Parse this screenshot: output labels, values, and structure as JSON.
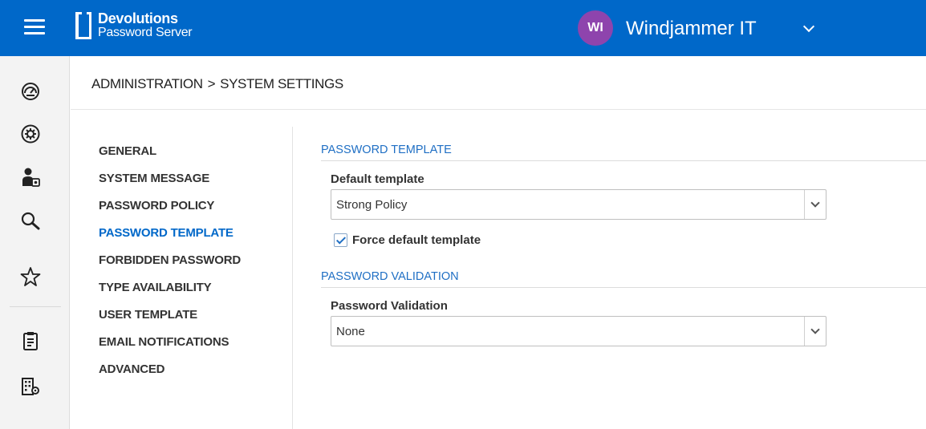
{
  "header": {
    "logo_line1": "Devolutions",
    "logo_line2": "Password Server",
    "account_initials": "WI",
    "account_name": "Windjammer IT",
    "brand_color": "#0068c9",
    "avatar_color": "#8e44ad"
  },
  "rail": {
    "icons": [
      "dashboard-icon",
      "settings-gear-icon",
      "user-admin-icon",
      "search-icon",
      "favorites-star-icon",
      "clipboard-report-icon",
      "org-settings-icon"
    ]
  },
  "breadcrumb": {
    "part1": "ADMINISTRATION",
    "separator": ">",
    "part2": "SYSTEM SETTINGS"
  },
  "nav": {
    "items": [
      {
        "label": "GENERAL"
      },
      {
        "label": "SYSTEM MESSAGE"
      },
      {
        "label": "PASSWORD POLICY"
      },
      {
        "label": "PASSWORD TEMPLATE",
        "active": true
      },
      {
        "label": "FORBIDDEN PASSWORD"
      },
      {
        "label": "TYPE AVAILABILITY"
      },
      {
        "label": "USER TEMPLATE"
      },
      {
        "label": "EMAIL NOTIFICATIONS"
      },
      {
        "label": "ADVANCED"
      }
    ]
  },
  "password_template": {
    "section_title": "PASSWORD TEMPLATE",
    "default_template_label": "Default template",
    "default_template_value": "Strong Policy",
    "force_default_label": "Force default template",
    "force_default_checked": true
  },
  "password_validation": {
    "section_title": "PASSWORD VALIDATION",
    "label": "Password Validation",
    "value": "None"
  }
}
